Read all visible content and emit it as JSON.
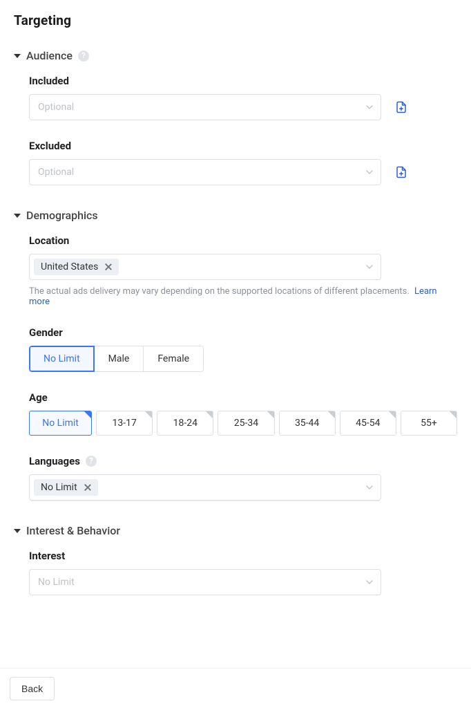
{
  "page": {
    "title": "Targeting"
  },
  "sections": {
    "audience": {
      "label": "Audience"
    },
    "demographics": {
      "label": "Demographics"
    },
    "interest_behavior": {
      "label": "Interest & Behavior"
    }
  },
  "audience": {
    "included": {
      "label": "Included",
      "placeholder": "Optional"
    },
    "excluded": {
      "label": "Excluded",
      "placeholder": "Optional"
    }
  },
  "demographics": {
    "location": {
      "label": "Location",
      "value": "United States",
      "hint": "The actual ads delivery may vary depending on the supported locations of different placements.",
      "learn_more": "Learn more"
    },
    "gender": {
      "label": "Gender",
      "options": {
        "nolimit": "No Limit",
        "male": "Male",
        "female": "Female"
      },
      "selected": "nolimit"
    },
    "age": {
      "label": "Age",
      "options": {
        "nolimit": "No Limit",
        "r13_17": "13-17",
        "r18_24": "18-24",
        "r25_34": "25-34",
        "r35_44": "35-44",
        "r45_54": "45-54",
        "r55p": "55+"
      },
      "selected": "nolimit"
    },
    "languages": {
      "label": "Languages",
      "value": "No Limit"
    }
  },
  "interest": {
    "label": "Interest",
    "placeholder": "No Limit"
  },
  "footer": {
    "back": "Back"
  }
}
